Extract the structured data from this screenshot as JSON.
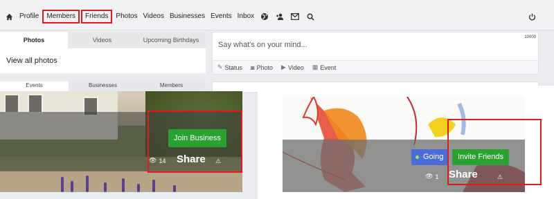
{
  "nav": {
    "items": [
      "Profile",
      "Members",
      "Friends",
      "Photos",
      "Videos",
      "Businesses",
      "Events",
      "Inbox"
    ],
    "highlighted": [
      "Members",
      "Friends"
    ],
    "icons": [
      "home-icon",
      "globe-icon",
      "person-add-icon",
      "mail-icon",
      "search-icon",
      "power-icon"
    ]
  },
  "left_panel": {
    "tabs": [
      "Photos",
      "Videos",
      "Upcoming Birthdays"
    ],
    "active_tab": "Photos",
    "view_all": "View all photos"
  },
  "left_panel_row2": {
    "tabs": [
      "Events",
      "Businesses",
      "Members"
    ]
  },
  "composer": {
    "placeholder": "Say what's on your mind...",
    "char_limit": "10000",
    "actions": [
      "Status",
      "Photo",
      "Video",
      "Event"
    ]
  },
  "card_left": {
    "button": "Join Business",
    "views": "14",
    "share": "Share"
  },
  "card_right": {
    "going": "Going",
    "button": "Invite Friends",
    "views": "1",
    "share": "Share"
  },
  "colors": {
    "highlight": "#e01b1b",
    "green_button": "#29a232",
    "blue_button": "#4a6dd8"
  }
}
